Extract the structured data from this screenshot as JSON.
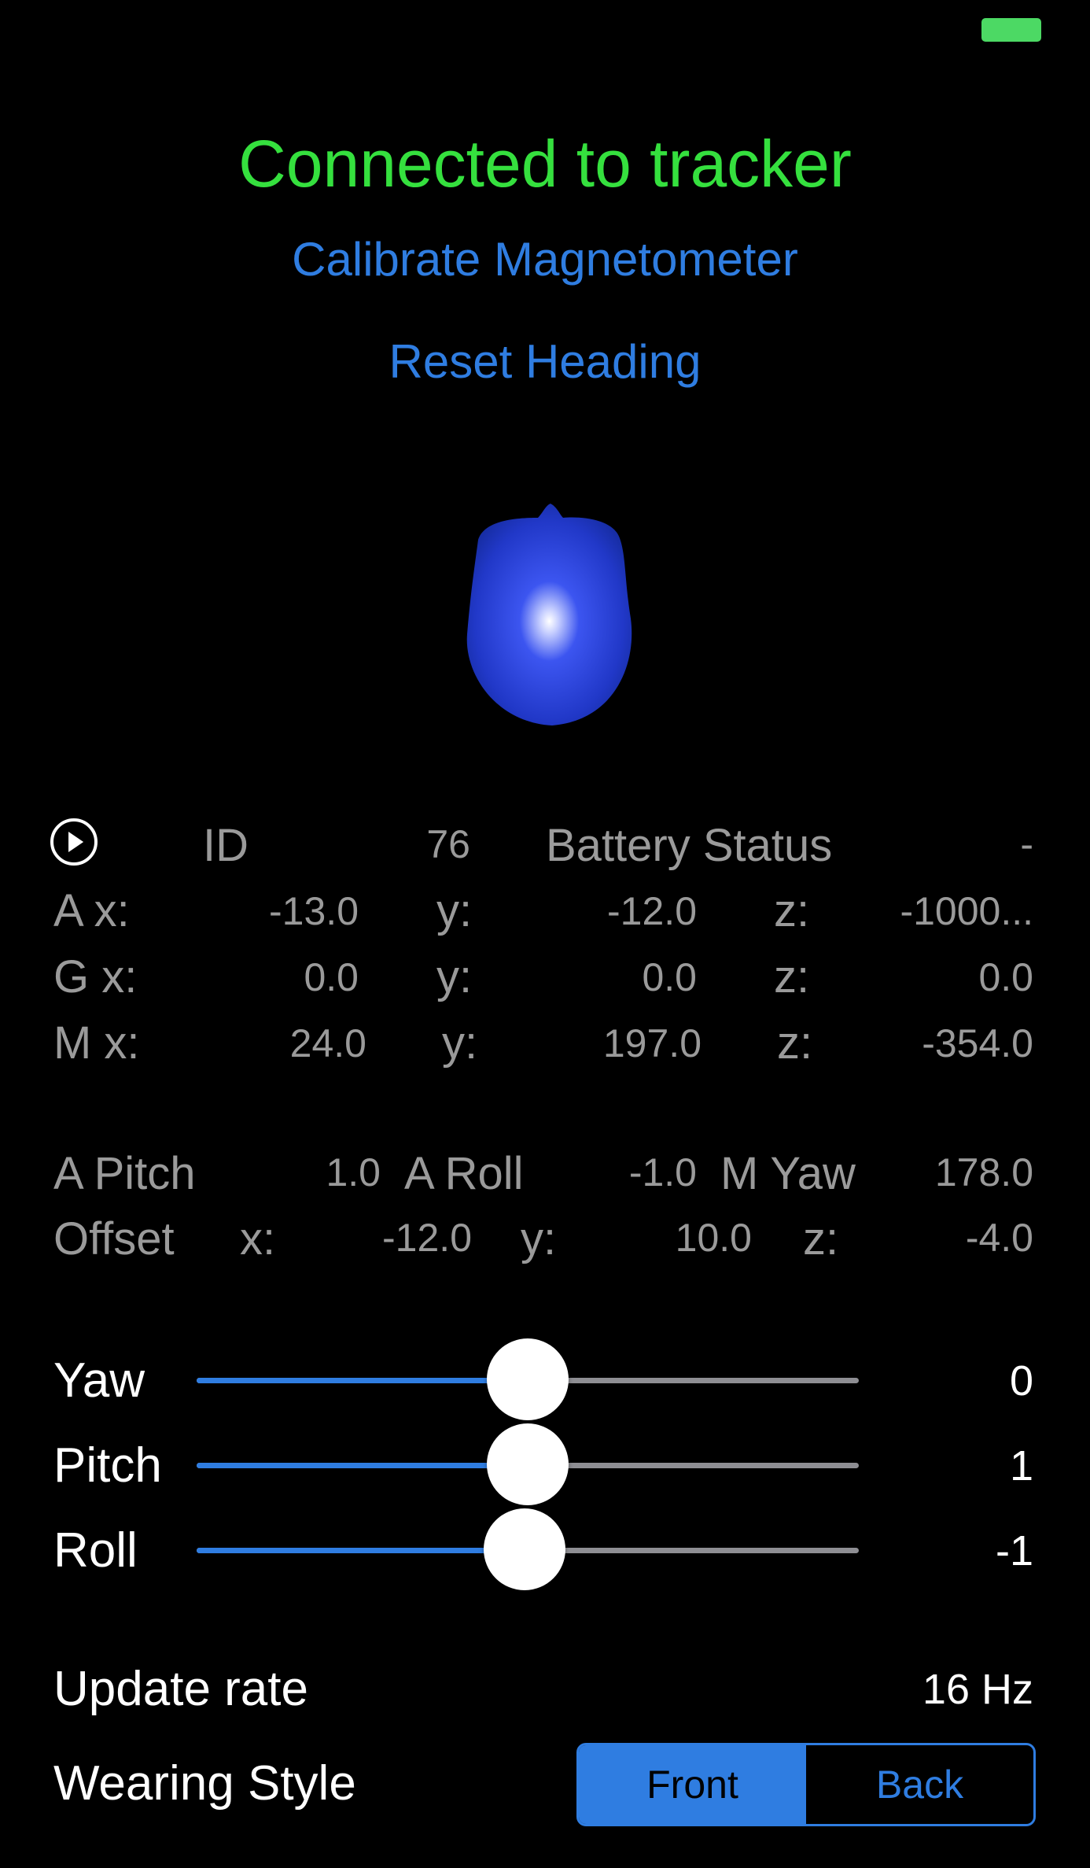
{
  "status": {
    "connection": "Connected to tracker",
    "connection_color": "#35e03e"
  },
  "actions": {
    "calibrate": "Calibrate Magnetometer",
    "reset_heading": "Reset Heading"
  },
  "telemetry": {
    "id_label": "ID",
    "id_value": "76",
    "battery_label": "Battery Status",
    "battery_value": "-",
    "accel": {
      "label": "A x:",
      "x": "-13.0",
      "y_label": "y:",
      "y": "-12.0",
      "z_label": "z:",
      "z": "-1000..."
    },
    "gyro": {
      "label": "G x:",
      "x": "0.0",
      "y_label": "y:",
      "y": "0.0",
      "z_label": "z:",
      "z": "0.0"
    },
    "mag": {
      "label": "M x:",
      "x": "24.0",
      "y_label": "y:",
      "y": "197.0",
      "z_label": "z:",
      "z": "-354.0"
    },
    "a_pitch_label": "A Pitch",
    "a_pitch": "1.0",
    "a_roll_label": "A Roll",
    "a_roll": "-1.0",
    "m_yaw_label": "M Yaw",
    "m_yaw": "178.0",
    "offset": {
      "label": "Offset",
      "x_label": "x:",
      "x": "-12.0",
      "y_label": "y:",
      "y": "10.0",
      "z_label": "z:",
      "z": "-4.0"
    }
  },
  "sliders": [
    {
      "label": "Yaw",
      "value": "0",
      "fraction": 0.5
    },
    {
      "label": "Pitch",
      "value": "1",
      "fraction": 0.5
    },
    {
      "label": "Roll",
      "value": "-1",
      "fraction": 0.495
    }
  ],
  "settings": {
    "update_rate_label": "Update rate",
    "update_rate_value": "16 Hz",
    "wearing_style_label": "Wearing Style",
    "wearing_options": [
      "Front",
      "Back"
    ],
    "wearing_selected": "Front"
  },
  "colors": {
    "accent": "#2f7de1",
    "secondary_text": "#9a9a9a",
    "battery": "#4cd964"
  }
}
